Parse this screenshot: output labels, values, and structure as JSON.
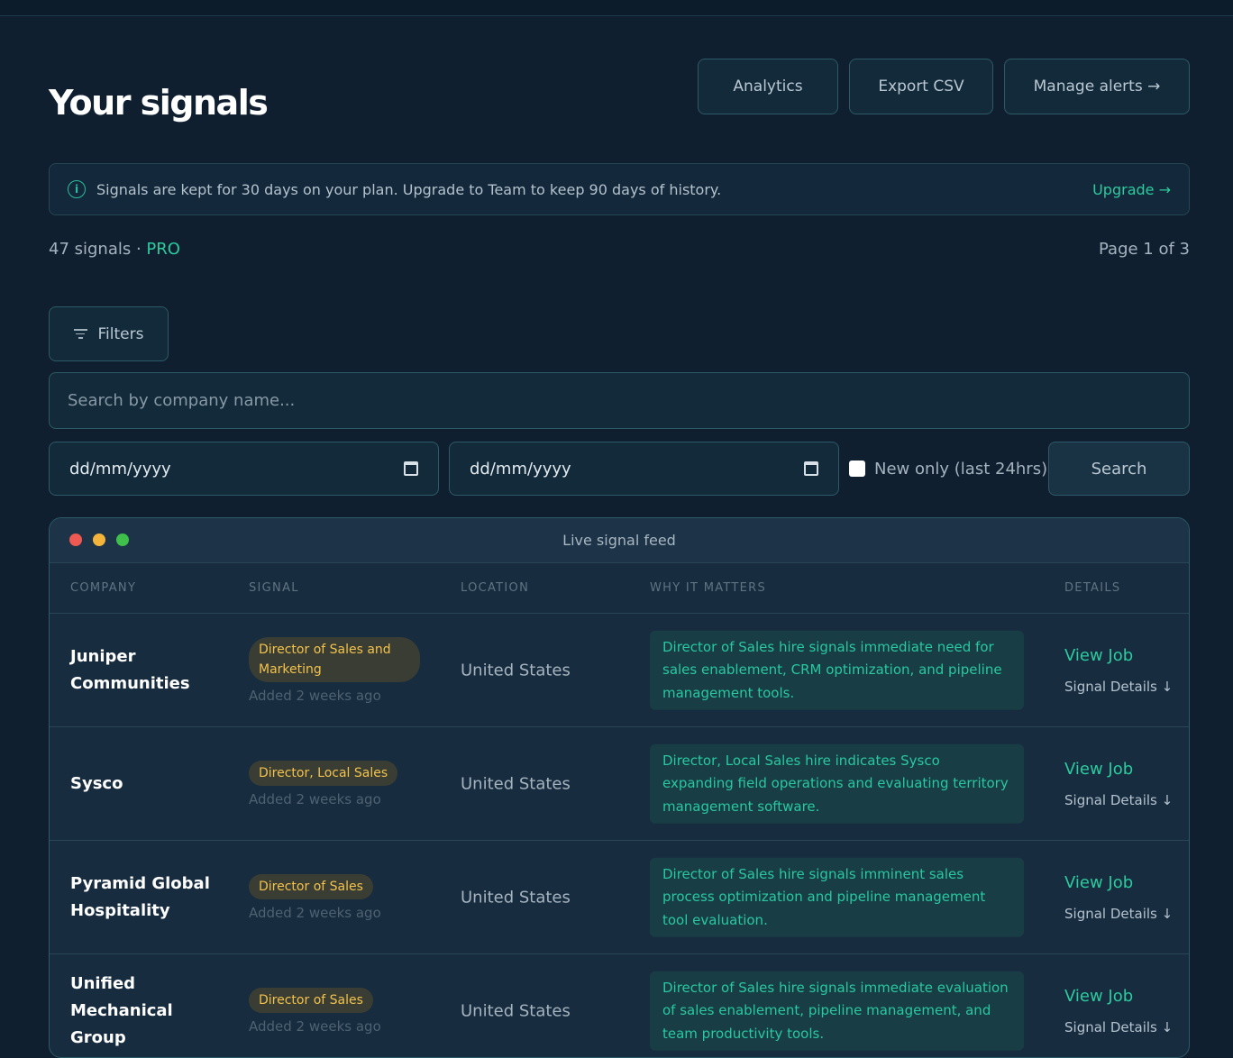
{
  "header": {
    "title": "Your signals",
    "buttons": {
      "analytics": "Analytics",
      "export": "Export CSV",
      "alerts": "Manage alerts →"
    }
  },
  "notice": {
    "icon": "info-icon",
    "text": "Signals are kept for 30 days on your plan. Upgrade to Team to keep 90 days of history.",
    "link": "Upgrade →"
  },
  "summary": {
    "count": "47 signals",
    "separator": " · ",
    "plan": "PRO",
    "page": "Page 1 of 3"
  },
  "controls": {
    "filters_label": "Filters",
    "search_placeholder": "Search by company name...",
    "date_from": "dd/mm/yyyy",
    "date_to": "dd/mm/yyyy",
    "new_only_label": "New only (last 24hrs)",
    "search_button": "Search"
  },
  "feed": {
    "title": "Live signal feed",
    "window_dots": [
      "#ee5a52",
      "#f2b43a",
      "#3fc04a"
    ],
    "columns": [
      "COMPANY",
      "SIGNAL",
      "LOCATION",
      "WHY IT MATTERS",
      "DETAILS"
    ],
    "rows": [
      {
        "company": "Juniper Communities",
        "signal": "Director of Sales and Marketing",
        "added": "Added 2 weeks ago",
        "location": "United States",
        "why": "Director of Sales hire signals immediate need for sales enablement, CRM optimization, and pipeline management tools.",
        "view_job": "View Job",
        "signal_details": "Signal Details ↓"
      },
      {
        "company": "Sysco",
        "signal": "Director, Local Sales",
        "added": "Added 2 weeks ago",
        "location": "United States",
        "why": "Director, Local Sales hire indicates Sysco expanding field operations and evaluating territory management software.",
        "view_job": "View Job",
        "signal_details": "Signal Details ↓"
      },
      {
        "company": "Pyramid Global Hospitality",
        "signal": "Director of Sales",
        "added": "Added 2 weeks ago",
        "location": "United States",
        "why": "Director of Sales hire signals imminent sales process optimization and pipeline management tool evaluation.",
        "view_job": "View Job",
        "signal_details": "Signal Details ↓"
      },
      {
        "company": "Unified Mechanical Group",
        "signal": "Director of Sales",
        "added": "Added 2 weeks ago",
        "location": "United States",
        "why": "Director of Sales hire signals immediate evaluation of sales enablement, pipeline management, and team productivity tools.",
        "view_job": "View Job",
        "signal_details": "Signal Details ↓"
      }
    ]
  },
  "colors": {
    "accent": "#2bcb9e",
    "badge_text": "#f2c24c",
    "background": "#0f1f30"
  }
}
